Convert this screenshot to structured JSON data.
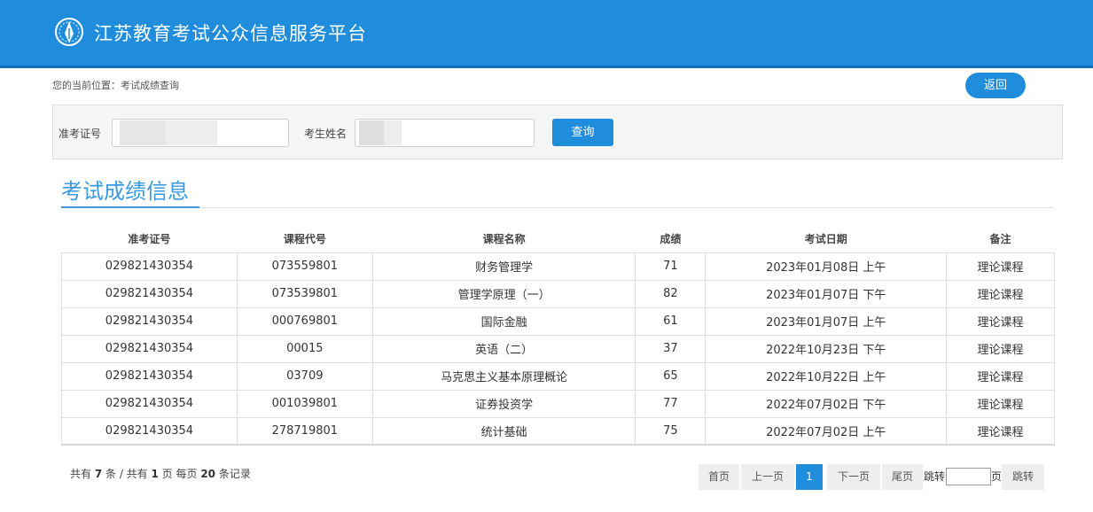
{
  "header": {
    "title": "江苏教育考试公众信息服务平台",
    "logo_icon": "pen-nib-emblem-icon",
    "color": "#1f8ddb"
  },
  "breadcrumb": "您的当前位置：考试成绩查询",
  "back_button": "返回",
  "search": {
    "ticket_label": "准考证号",
    "ticket_value": "",
    "name_label": "考生姓名",
    "name_value": "",
    "query_button": "查询"
  },
  "section_title": "考试成绩信息",
  "table": {
    "columns": [
      "准考证号",
      "课程代号",
      "课程名称",
      "成绩",
      "考试日期",
      "备注"
    ],
    "rows": [
      [
        "029821430354",
        "073559801",
        "财务管理学",
        "71",
        "2023年01月08日 上午",
        "理论课程"
      ],
      [
        "029821430354",
        "073539801",
        "管理学原理（一）",
        "82",
        "2023年01月07日 下午",
        "理论课程"
      ],
      [
        "029821430354",
        "000769801",
        "国际金融",
        "61",
        "2023年01月07日 上午",
        "理论课程"
      ],
      [
        "029821430354",
        "00015",
        "英语（二）",
        "37",
        "2022年10月23日 下午",
        "理论课程"
      ],
      [
        "029821430354",
        "03709",
        "马克思主义基本原理概论",
        "65",
        "2022年10月22日 上午",
        "理论课程"
      ],
      [
        "029821430354",
        "001039801",
        "证券投资学",
        "77",
        "2022年07月02日 下午",
        "理论课程"
      ],
      [
        "029821430354",
        "278719801",
        "统计基础",
        "75",
        "2022年07月02日 上午",
        "理论课程"
      ]
    ]
  },
  "summary": {
    "prefix": "共有 ",
    "total_records": "7",
    "mid1": " 条 / 共有 ",
    "total_pages": "1",
    "mid2": " 页 每页 ",
    "per_page": "20",
    "suffix": " 条记录"
  },
  "pagination": {
    "first": "首页",
    "prev": "上一页",
    "current": "1",
    "next": "下一页",
    "last": "尾页",
    "jump_prefix": "跳转",
    "jump_suffix": "页",
    "jump_button": "跳转",
    "jump_value": ""
  }
}
